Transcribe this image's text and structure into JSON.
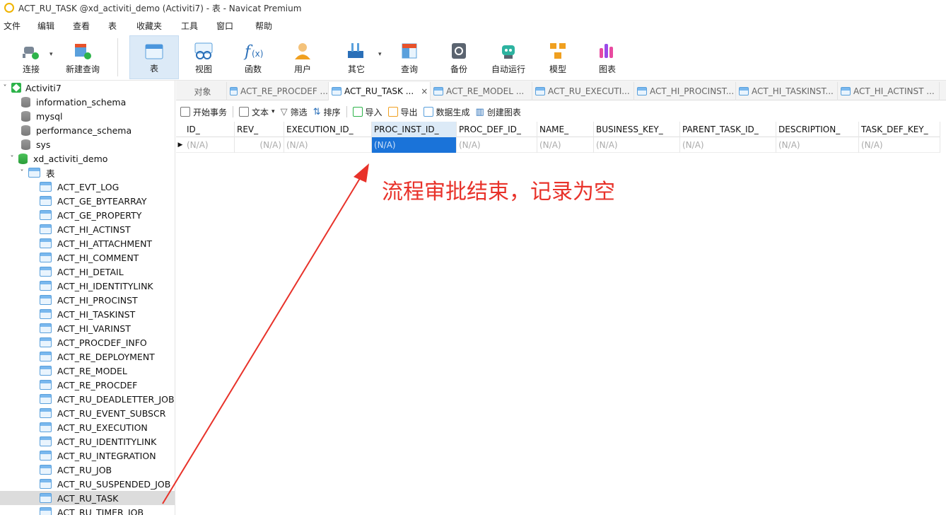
{
  "window": {
    "title": "ACT_RU_TASK @xd_activiti_demo (Activiti7) - 表 - Navicat Premium"
  },
  "menu": [
    "文件",
    "编辑",
    "查看",
    "表",
    "收藏夹",
    "工具",
    "窗口",
    "帮助"
  ],
  "toolbar": {
    "connect": "连接",
    "new_query": "新建查询",
    "table": "表",
    "view": "视图",
    "function": "函数",
    "user": "用户",
    "other": "其它",
    "query": "查询",
    "backup": "备份",
    "automation": "自动运行",
    "model": "模型",
    "chart": "图表"
  },
  "sidebar": {
    "connection": "Activiti7",
    "databases": [
      "information_schema",
      "mysql",
      "performance_schema",
      "sys"
    ],
    "active_db": "xd_activiti_demo",
    "tables_folder": "表",
    "tables": [
      "ACT_EVT_LOG",
      "ACT_GE_BYTEARRAY",
      "ACT_GE_PROPERTY",
      "ACT_HI_ACTINST",
      "ACT_HI_ATTACHMENT",
      "ACT_HI_COMMENT",
      "ACT_HI_DETAIL",
      "ACT_HI_IDENTITYLINK",
      "ACT_HI_PROCINST",
      "ACT_HI_TASKINST",
      "ACT_HI_VARINST",
      "ACT_PROCDEF_INFO",
      "ACT_RE_DEPLOYMENT",
      "ACT_RE_MODEL",
      "ACT_RE_PROCDEF",
      "ACT_RU_DEADLETTER_JOB",
      "ACT_RU_EVENT_SUBSCR",
      "ACT_RU_EXECUTION",
      "ACT_RU_IDENTITYLINK",
      "ACT_RU_INTEGRATION",
      "ACT_RU_JOB",
      "ACT_RU_SUSPENDED_JOB",
      "ACT_RU_TASK",
      "ACT_RU_TIMER_JOB"
    ],
    "selected_table": "ACT_RU_TASK"
  },
  "tabs": {
    "objects": "对象",
    "items": [
      "ACT_RE_PROCDEF ...",
      "ACT_RU_TASK ...",
      "ACT_RE_MODEL ...",
      "ACT_RU_EXECUTI...",
      "ACT_HI_PROCINST...",
      "ACT_HI_TASKINST...",
      "ACT_HI_ACTINST ..."
    ],
    "close": "×"
  },
  "subtoolbar": {
    "begin_tx": "开始事务",
    "text": "文本",
    "filter": "筛选",
    "sort": "排序",
    "import": "导入",
    "export": "导出",
    "data_gen": "数据生成",
    "create_chart": "创建图表"
  },
  "grid": {
    "columns": [
      "ID_",
      "REV_",
      "EXECUTION_ID_",
      "PROC_INST_ID_",
      "PROC_DEF_ID_",
      "NAME_",
      "BUSINESS_KEY_",
      "PARENT_TASK_ID_",
      "DESCRIPTION_",
      "TASK_DEF_KEY_"
    ],
    "row": [
      "(N/A)",
      "(N/A)",
      "(N/A)",
      "(N/A)",
      "(N/A)",
      "(N/A)",
      "(N/A)",
      "(N/A)",
      "(N/A)",
      "(N/A)"
    ],
    "selected_column": "PROC_INST_ID_"
  },
  "annotation": {
    "text": "流程审批结束，记录为空",
    "color": "#e8322a"
  }
}
